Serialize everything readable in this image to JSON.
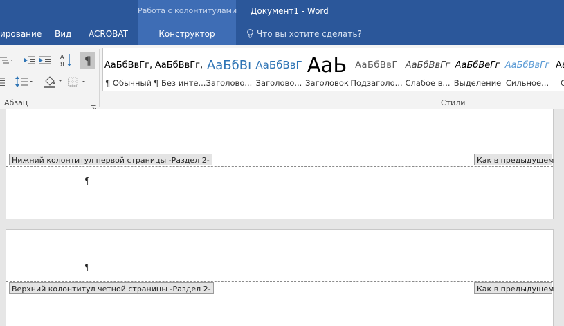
{
  "titlebar": {
    "context_group": "Работа с колонтитулами",
    "document_title": "Документ1 - Word"
  },
  "tabs": [
    {
      "label": "ирование"
    },
    {
      "label": "Вид"
    },
    {
      "label": "ACROBAT"
    },
    {
      "label": "Конструктор",
      "active": true
    }
  ],
  "tell_me": "Что вы хотите сделать?",
  "ribbon": {
    "paragraph_group_label": "Абзац",
    "styles_group_label": "Стили",
    "styles": [
      {
        "sample": "АаБбВвГг,",
        "name": "¶ Обычный"
      },
      {
        "sample": "АаБбВвГг,",
        "name": "¶ Без инте..."
      },
      {
        "sample": "АаБбВı",
        "name": "Заголово..."
      },
      {
        "sample": "АаБбВвГ",
        "name": "Заголово..."
      },
      {
        "sample": "АаЬ",
        "name": "Заголовок"
      },
      {
        "sample": "АаБбВвГ",
        "name": "Подзаголо..."
      },
      {
        "sample": "АаБбВвГг",
        "name": "Слабое в..."
      },
      {
        "sample": "АаБбВеГг",
        "name": "Выделение"
      },
      {
        "sample": "АаБбВвГг",
        "name": "Сильное..."
      },
      {
        "sample": "Аа",
        "name": "С"
      }
    ]
  },
  "document": {
    "footer_first": {
      "label": "Нижний колонтитул первой страницы -Раздел 2-",
      "same_as_previous": "Как в предыдущем",
      "pilcrow": "¶"
    },
    "header_even": {
      "label": "Верхний колонтитул четной страницы -Раздел 2-",
      "same_as_previous": "Как в предыдущем",
      "pilcrow": "¶"
    }
  },
  "colors": {
    "title_bar": "#2b579a",
    "context_tab": "#3e6db5",
    "heading_blue": "#2e74b5"
  }
}
